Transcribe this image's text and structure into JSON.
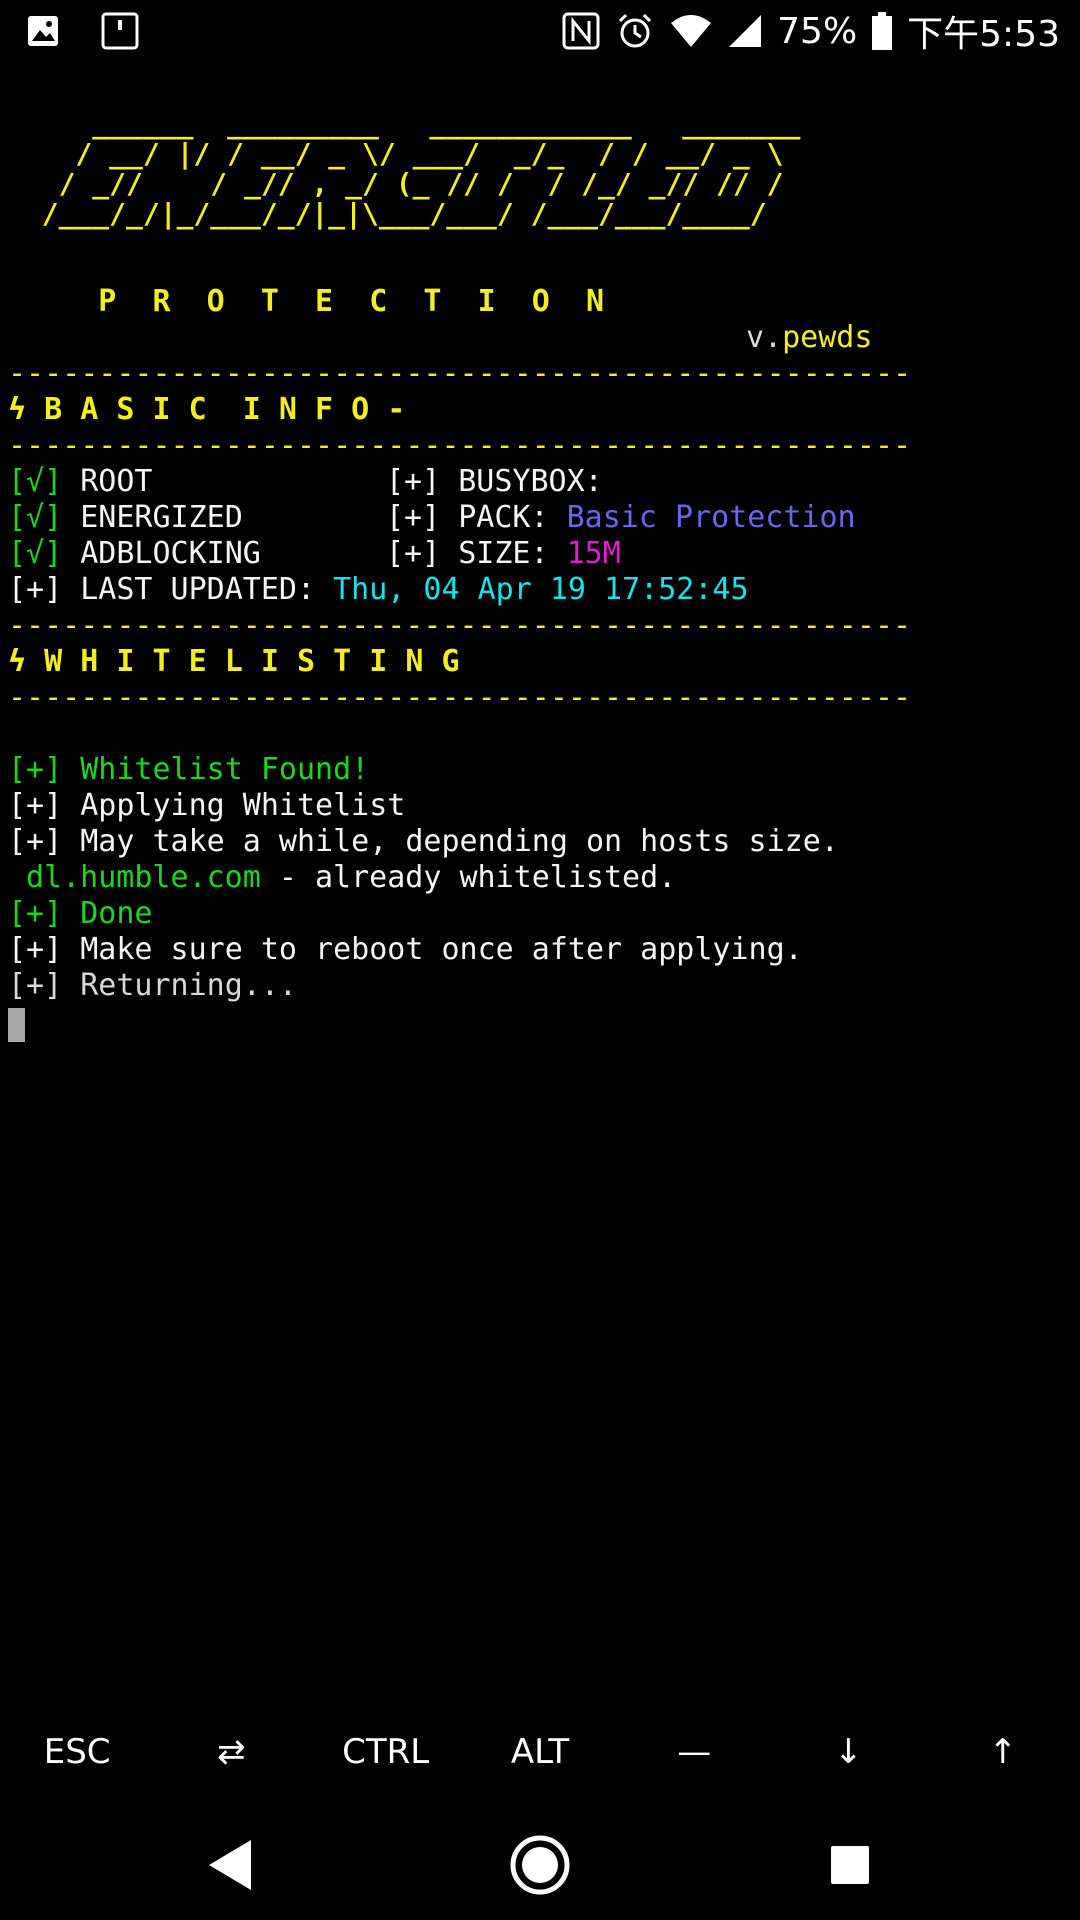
{
  "status_bar": {
    "battery": "75%",
    "time": "下午5:53",
    "left_icons": [
      "image-icon",
      "sd-card-icon"
    ],
    "right_icons": [
      "nfc-icon",
      "alarm-icon",
      "wifi-icon",
      "signal-icon",
      "battery-icon"
    ]
  },
  "terminal": {
    "banner": [
      "     ______  _________   ____________   _______",
      "    / __/ |/ / __/ _ \\/ ___/  _/_  / / __/ _ \\",
      "   / _//    / _// , _/ (_ // /  / /_/ _// // /",
      "  /___/_/|_/___/_/|_|\\___/___/ /___/___/____/"
    ],
    "subtitle": "     P  R  O  T  E  C  T  I  O  N",
    "version_prefix": "v.",
    "version": "pewds",
    "separator": "--------------------------------------------------",
    "section_basic": "ϟ B A S I C  I N F O -",
    "section_whitelist": "ϟ W H I T E L I S T I N G",
    "checks": {
      "mark": "[√]",
      "root": "ROOT",
      "energized": "ENERGIZED",
      "adblocking": "ADBLOCKING"
    },
    "plus": "[+]",
    "busybox_label": "BUSYBOX:",
    "pack_label": "PACK:",
    "pack_value": "Basic Protection",
    "size_label": "SIZE:",
    "size_value": "15M",
    "last_updated_label": "LAST UPDATED:",
    "last_updated_value": "Thu, 04 Apr 19 17:52:45",
    "log": {
      "found": "Whitelist Found!",
      "applying": "Applying Whitelist",
      "may_take": "May take a while, depending on hosts size.",
      "domain": "dl.humble.com",
      "already": " - already whitelisted.",
      "done": "Done",
      "reboot": "Make sure to reboot once after applying.",
      "returning": "Returning..."
    }
  },
  "extra_keys": [
    "ESC",
    "⇄",
    "CTRL",
    "ALT",
    "—",
    "↓",
    "↑"
  ],
  "nav_icons": [
    "back-icon",
    "home-icon",
    "recents-icon"
  ]
}
